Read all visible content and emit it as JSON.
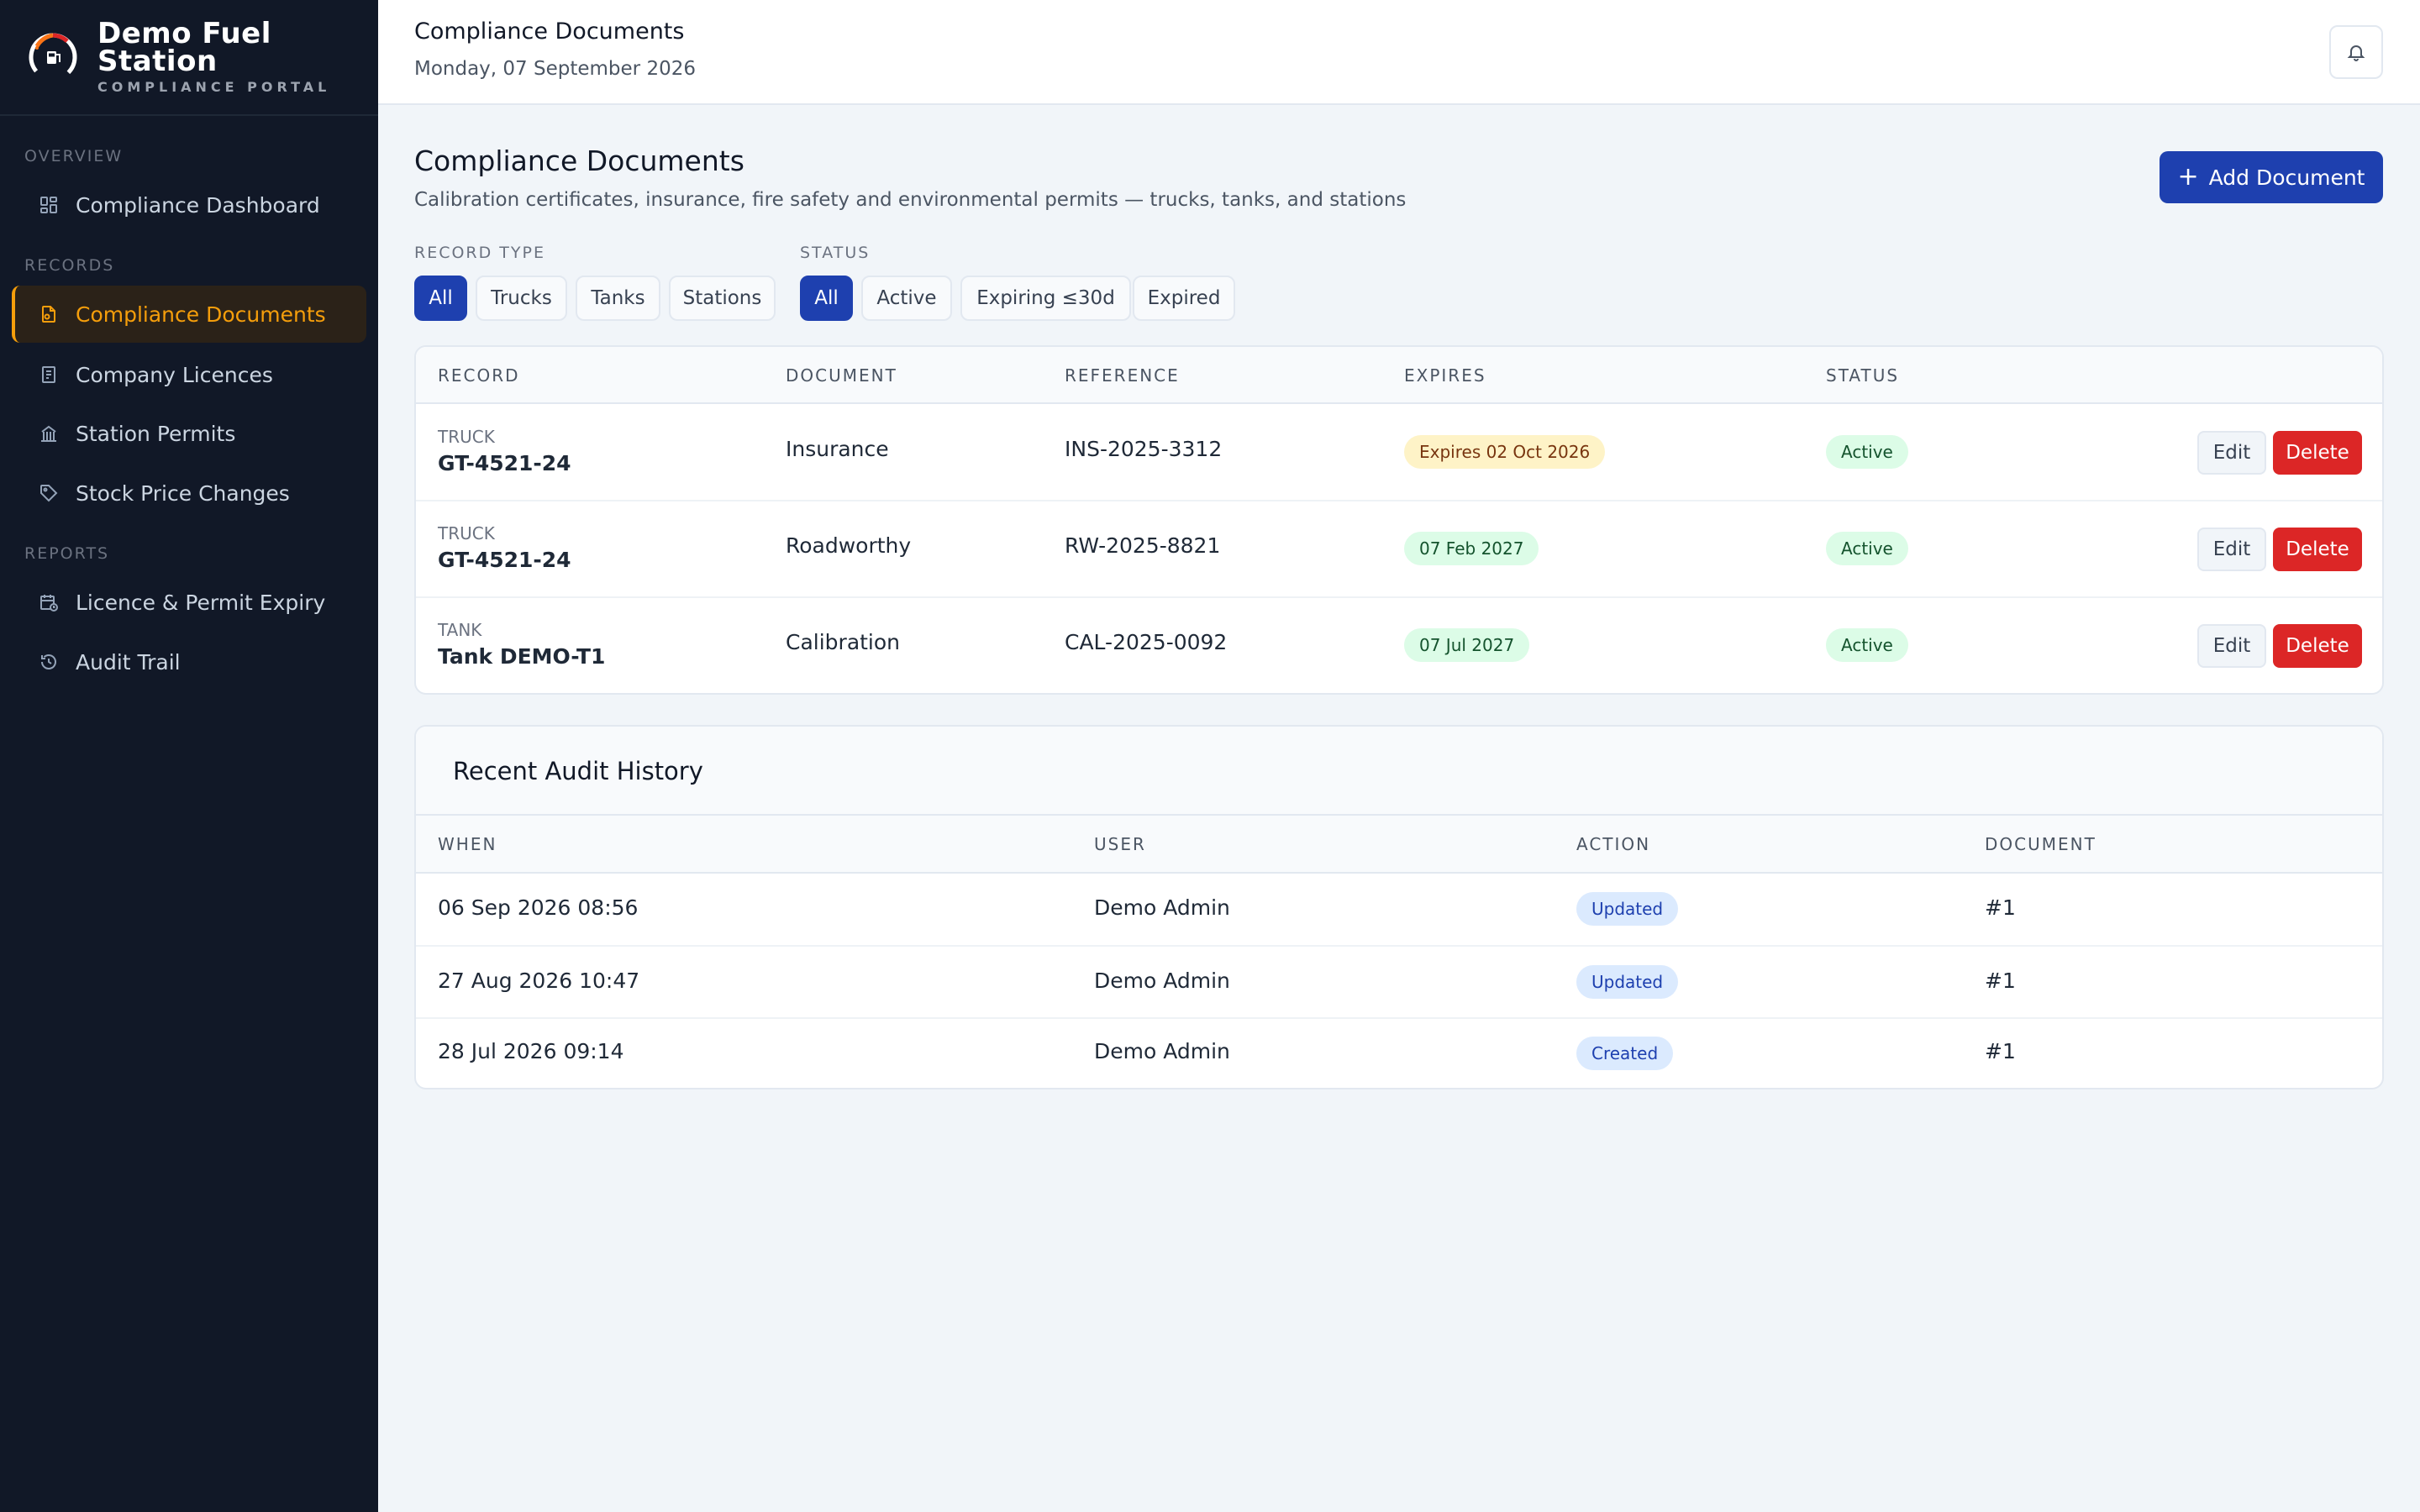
{
  "brand": {
    "name_line1": "Demo Fuel",
    "name_line2": "Station",
    "subtitle": "COMPLIANCE PORTAL"
  },
  "sidebar": {
    "sections": [
      {
        "label": "OVERVIEW"
      },
      {
        "label": "RECORDS"
      },
      {
        "label": "REPORTS"
      }
    ],
    "items": [
      {
        "label": "Compliance Dashboard",
        "icon": "dashboard-icon"
      },
      {
        "label": "Compliance Documents",
        "icon": "document-icon",
        "active": true
      },
      {
        "label": "Company Licences",
        "icon": "certificate-icon"
      },
      {
        "label": "Station Permits",
        "icon": "building-icon"
      },
      {
        "label": "Stock Price Changes",
        "icon": "tag-icon"
      },
      {
        "label": "Licence & Permit Expiry",
        "icon": "calendar-clock-icon"
      },
      {
        "label": "Audit Trail",
        "icon": "history-icon"
      }
    ]
  },
  "topbar": {
    "title": "Compliance Documents",
    "date": "Monday, 07 September 2026",
    "bell_icon": "bell-icon"
  },
  "header": {
    "title": "Compliance Documents",
    "subtitle": "Calibration certificates, insurance, fire safety and environmental permits — trucks, tanks, and stations",
    "add_button": "Add Document",
    "add_icon": "+"
  },
  "filters": {
    "record_type_label": "RECORD TYPE",
    "record_types": [
      "All",
      "Trucks",
      "Tanks",
      "Stations"
    ],
    "record_type_selected": "All",
    "status_label": "STATUS",
    "statuses": [
      "All",
      "Active",
      "Expiring ≤30d",
      "Expired"
    ],
    "status_selected": "All"
  },
  "documents": {
    "columns": [
      "RECORD",
      "DOCUMENT",
      "REFERENCE",
      "EXPIRES",
      "STATUS"
    ],
    "rows": [
      {
        "type": "TRUCK",
        "record": "GT-4521-24",
        "document": "Insurance",
        "reference": "INS-2025-3312",
        "expires": "Expires 02 Oct 2026",
        "expires_state": "warn",
        "status": "Active"
      },
      {
        "type": "TRUCK",
        "record": "GT-4521-24",
        "document": "Roadworthy",
        "reference": "RW-2025-8821",
        "expires": "07 Feb 2027",
        "expires_state": "ok",
        "status": "Active"
      },
      {
        "type": "TANK",
        "record": "Tank DEMO-T1",
        "document": "Calibration",
        "reference": "CAL-2025-0092",
        "expires": "07 Jul 2027",
        "expires_state": "ok",
        "status": "Active"
      }
    ],
    "edit_label": "Edit",
    "delete_label": "Delete"
  },
  "audit": {
    "title": "Recent Audit History",
    "columns": [
      "WHEN",
      "USER",
      "ACTION",
      "DOCUMENT"
    ],
    "rows": [
      {
        "when": "06 Sep 2026 08:56",
        "user": "Demo Admin",
        "action": "Updated",
        "document": "#1"
      },
      {
        "when": "27 Aug 2026 10:47",
        "user": "Demo Admin",
        "action": "Updated",
        "document": "#1"
      },
      {
        "when": "28 Jul 2026 09:14",
        "user": "Demo Admin",
        "action": "Created",
        "document": "#1"
      }
    ]
  },
  "colors": {
    "sidebar_bg": "#111827",
    "accent_amber": "#f59e0b",
    "primary_blue": "#1e40af",
    "danger_red": "#dc2626"
  }
}
